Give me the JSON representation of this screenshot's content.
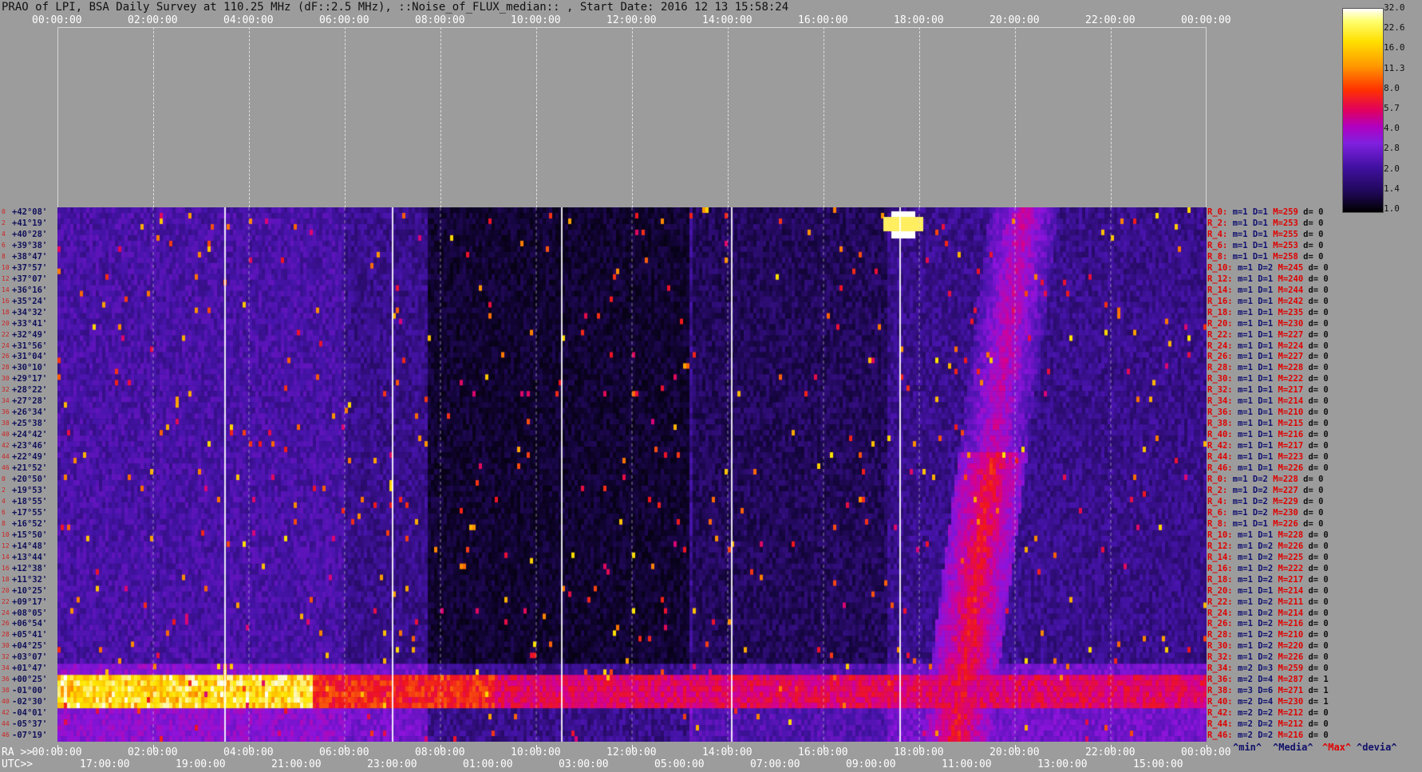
{
  "title": "PRAO of LPI, BSA Daily Survey at 110.25 MHz (dF::2.5 MHz), ::Noise_of_FLUX_median:: , Start Date: 2016 12 13 15:58:24",
  "top_axis": [
    "00:00:00",
    "02:00:00",
    "04:00:00",
    "06:00:00",
    "08:00:00",
    "10:00:00",
    "12:00:00",
    "14:00:00",
    "16:00:00",
    "18:00:00",
    "20:00:00",
    "22:00:00",
    "00:00:00"
  ],
  "ra_axis": {
    "prefix": "RA >>",
    "ticks": [
      "00:00:00",
      "02:00:00",
      "04:00:00",
      "06:00:00",
      "08:00:00",
      "10:00:00",
      "12:00:00",
      "14:00:00",
      "16:00:00",
      "18:00:00",
      "20:00:00",
      "22:00:00",
      "00:00:00"
    ]
  },
  "utc_axis": {
    "prefix": "UTC>>",
    "ticks": [
      "17:00:00",
      "19:00:00",
      "21:00:00",
      "23:00:00",
      "01:00:00",
      "03:00:00",
      "05:00:00",
      "07:00:00",
      "09:00:00",
      "11:00:00",
      "13:00:00",
      "15:00:00"
    ]
  },
  "colorbar": {
    "ticks": [
      "32.0",
      "22.6",
      "16.0",
      "11.3",
      "8.0",
      "5.7",
      "4.0",
      "2.8",
      "2.0",
      "1.4",
      "1.0"
    ]
  },
  "legend": {
    "min": "^min^",
    "median": "^Media^",
    "max": "^Max^",
    "dev": "^devia^"
  },
  "dec_labels": [
    "+42°08'",
    "+41°19'",
    "+40°28'",
    "+39°38'",
    "+38°47'",
    "+37°57'",
    "+37°07'",
    "+36°16'",
    "+35°24'",
    "+34°32'",
    "+33°41'",
    "+32°49'",
    "+31°56'",
    "+31°04'",
    "+30°10'",
    "+29°17'",
    "+28°22'",
    "+27°28'",
    "+26°34'",
    "+25°38'",
    "+24°42'",
    "+23°46'",
    "+22°49'",
    "+21°52'",
    "+20°50'",
    "+19°53'",
    "+18°55'",
    "+17°55'",
    "+16°52'",
    "+15°50'",
    "+14°48'",
    "+13°44'",
    "+12°38'",
    "+11°32'",
    "+10°25'",
    "+09°17'",
    "+08°05'",
    "+06°54'",
    "+05°41'",
    "+04°25'",
    "+03°07'",
    "+01°47'",
    "+00°25'",
    "-01°00'",
    "-02°30'",
    "-04°01'",
    "-05°37'",
    "-07°19'"
  ],
  "row_numbers": [
    "0",
    "2",
    "4",
    "6",
    "8",
    "10",
    "12",
    "14",
    "16",
    "18",
    "20",
    "22",
    "24",
    "26",
    "28",
    "30",
    "32",
    "34",
    "36",
    "38",
    "40",
    "42",
    "44",
    "46",
    "0",
    "2",
    "4",
    "6",
    "8",
    "10",
    "12",
    "14",
    "16",
    "18",
    "20",
    "22",
    "24",
    "26",
    "28",
    "30",
    "32",
    "34",
    "36",
    "38",
    "40",
    "42",
    "44",
    "46"
  ],
  "stats": [
    {
      "r": "R_0:",
      "m": "m=1",
      "d": "D=1",
      "M": "M=259",
      "dd": "d= 0"
    },
    {
      "r": "R_2:",
      "m": "m=1",
      "d": "D=1",
      "M": "M=253",
      "dd": "d= 0"
    },
    {
      "r": "R_4:",
      "m": "m=1",
      "d": "D=1",
      "M": "M=255",
      "dd": "d= 0"
    },
    {
      "r": "R_6:",
      "m": "m=1",
      "d": "D=1",
      "M": "M=253",
      "dd": "d= 0"
    },
    {
      "r": "R_8:",
      "m": "m=1",
      "d": "D=1",
      "M": "M=258",
      "dd": "d= 0"
    },
    {
      "r": "R_10:",
      "m": "m=1",
      "d": "D=2",
      "M": "M=245",
      "dd": "d= 0"
    },
    {
      "r": "R_12:",
      "m": "m=1",
      "d": "D=1",
      "M": "M=240",
      "dd": "d= 0"
    },
    {
      "r": "R_14:",
      "m": "m=1",
      "d": "D=1",
      "M": "M=244",
      "dd": "d= 0"
    },
    {
      "r": "R_16:",
      "m": "m=1",
      "d": "D=1",
      "M": "M=242",
      "dd": "d= 0"
    },
    {
      "r": "R_18:",
      "m": "m=1",
      "d": "D=1",
      "M": "M=235",
      "dd": "d= 0"
    },
    {
      "r": "R_20:",
      "m": "m=1",
      "d": "D=1",
      "M": "M=230",
      "dd": "d= 0"
    },
    {
      "r": "R_22:",
      "m": "m=1",
      "d": "D=1",
      "M": "M=227",
      "dd": "d= 0"
    },
    {
      "r": "R_24:",
      "m": "m=1",
      "d": "D=1",
      "M": "M=224",
      "dd": "d= 0"
    },
    {
      "r": "R_26:",
      "m": "m=1",
      "d": "D=1",
      "M": "M=227",
      "dd": "d= 0"
    },
    {
      "r": "R_28:",
      "m": "m=1",
      "d": "D=1",
      "M": "M=228",
      "dd": "d= 0"
    },
    {
      "r": "R_30:",
      "m": "m=1",
      "d": "D=1",
      "M": "M=222",
      "dd": "d= 0"
    },
    {
      "r": "R_32:",
      "m": "m=1",
      "d": "D=1",
      "M": "M=217",
      "dd": "d= 0"
    },
    {
      "r": "R_34:",
      "m": "m=1",
      "d": "D=1",
      "M": "M=214",
      "dd": "d= 0"
    },
    {
      "r": "R_36:",
      "m": "m=1",
      "d": "D=1",
      "M": "M=210",
      "dd": "d= 0"
    },
    {
      "r": "R_38:",
      "m": "m=1",
      "d": "D=1",
      "M": "M=215",
      "dd": "d= 0"
    },
    {
      "r": "R_40:",
      "m": "m=1",
      "d": "D=1",
      "M": "M=216",
      "dd": "d= 0"
    },
    {
      "r": "R_42:",
      "m": "m=1",
      "d": "D=1",
      "M": "M=217",
      "dd": "d= 0"
    },
    {
      "r": "R_44:",
      "m": "m=1",
      "d": "D=1",
      "M": "M=223",
      "dd": "d= 0"
    },
    {
      "r": "R_46:",
      "m": "m=1",
      "d": "D=1",
      "M": "M=226",
      "dd": "d= 0"
    },
    {
      "r": "R_0:",
      "m": "m=1",
      "d": "D=2",
      "M": "M=228",
      "dd": "d= 0"
    },
    {
      "r": "R_2:",
      "m": "m=1",
      "d": "D=2",
      "M": "M=227",
      "dd": "d= 0"
    },
    {
      "r": "R_4:",
      "m": "m=1",
      "d": "D=2",
      "M": "M=229",
      "dd": "d= 0"
    },
    {
      "r": "R_6:",
      "m": "m=1",
      "d": "D=2",
      "M": "M=230",
      "dd": "d= 0"
    },
    {
      "r": "R_8:",
      "m": "m=1",
      "d": "D=1",
      "M": "M=226",
      "dd": "d= 0"
    },
    {
      "r": "R_10:",
      "m": "m=1",
      "d": "D=1",
      "M": "M=228",
      "dd": "d= 0"
    },
    {
      "r": "R_12:",
      "m": "m=1",
      "d": "D=2",
      "M": "M=226",
      "dd": "d= 0"
    },
    {
      "r": "R_14:",
      "m": "m=1",
      "d": "D=2",
      "M": "M=225",
      "dd": "d= 0"
    },
    {
      "r": "R_16:",
      "m": "m=1",
      "d": "D=2",
      "M": "M=222",
      "dd": "d= 0"
    },
    {
      "r": "R_18:",
      "m": "m=1",
      "d": "D=2",
      "M": "M=217",
      "dd": "d= 0"
    },
    {
      "r": "R_20:",
      "m": "m=1",
      "d": "D=1",
      "M": "M=214",
      "dd": "d= 0"
    },
    {
      "r": "R_22:",
      "m": "m=1",
      "d": "D=2",
      "M": "M=211",
      "dd": "d= 0"
    },
    {
      "r": "R_24:",
      "m": "m=1",
      "d": "D=2",
      "M": "M=214",
      "dd": "d= 0"
    },
    {
      "r": "R_26:",
      "m": "m=1",
      "d": "D=2",
      "M": "M=216",
      "dd": "d= 0"
    },
    {
      "r": "R_28:",
      "m": "m=1",
      "d": "D=2",
      "M": "M=210",
      "dd": "d= 0"
    },
    {
      "r": "R_30:",
      "m": "m=1",
      "d": "D=2",
      "M": "M=220",
      "dd": "d= 0"
    },
    {
      "r": "R_32:",
      "m": "m=1",
      "d": "D=2",
      "M": "M=226",
      "dd": "d= 0"
    },
    {
      "r": "R_34:",
      "m": "m=2",
      "d": "D=3",
      "M": "M=259",
      "dd": "d= 0"
    },
    {
      "r": "R_36:",
      "m": "m=2",
      "d": "D=4",
      "M": "M=287",
      "dd": "d= 1"
    },
    {
      "r": "R_38:",
      "m": "m=3",
      "d": "D=6",
      "M": "M=271",
      "dd": "d= 1"
    },
    {
      "r": "R_40:",
      "m": "m=2",
      "d": "D=4",
      "M": "M=230",
      "dd": "d= 1"
    },
    {
      "r": "R_42:",
      "m": "m=2",
      "d": "D=2",
      "M": "M=212",
      "dd": "d= 0"
    },
    {
      "r": "R_44:",
      "m": "m=2",
      "d": "D=2",
      "M": "M=212",
      "dd": "d= 0"
    },
    {
      "r": "R_46:",
      "m": "m=2",
      "d": "D=2",
      "M": "M=216",
      "dd": "d= 0"
    }
  ]
}
